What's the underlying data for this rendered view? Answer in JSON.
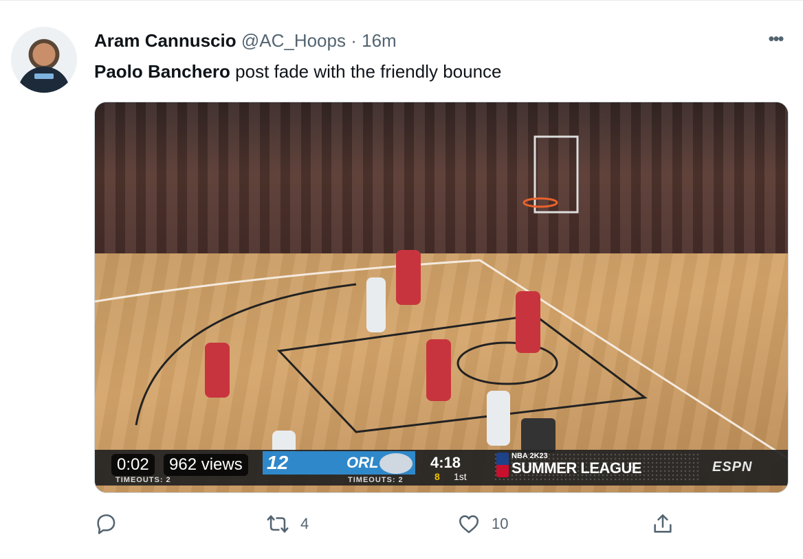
{
  "author": {
    "name": "Aram Cannuscio",
    "handle": "@AC_Hoops",
    "separator": "·",
    "time": "16m"
  },
  "tweet": {
    "mention": "Paolo Banchero",
    "text": " post fade with the friendly bounce"
  },
  "video": {
    "time": "0:02",
    "views": "962 views",
    "scorebug": {
      "home_score": "12",
      "home_team": "ORL",
      "timeouts_left": "TIMEOUTS: 2",
      "timeouts_right": "TIMEOUTS: 2",
      "clock": "4:18",
      "shot_clock": "8",
      "period": "1st",
      "league_top": "NBA 2K23",
      "league": "SUMMER LEAGUE",
      "network": "ESPN"
    }
  },
  "actions": {
    "reply_icon": "reply-icon",
    "retweet_icon": "retweet-icon",
    "retweet_count": "4",
    "like_icon": "heart-icon",
    "like_count": "10",
    "share_icon": "share-icon"
  },
  "colors": {
    "text": "#0f1419",
    "secondary": "#536471",
    "score_blue": "#2f88c9"
  }
}
